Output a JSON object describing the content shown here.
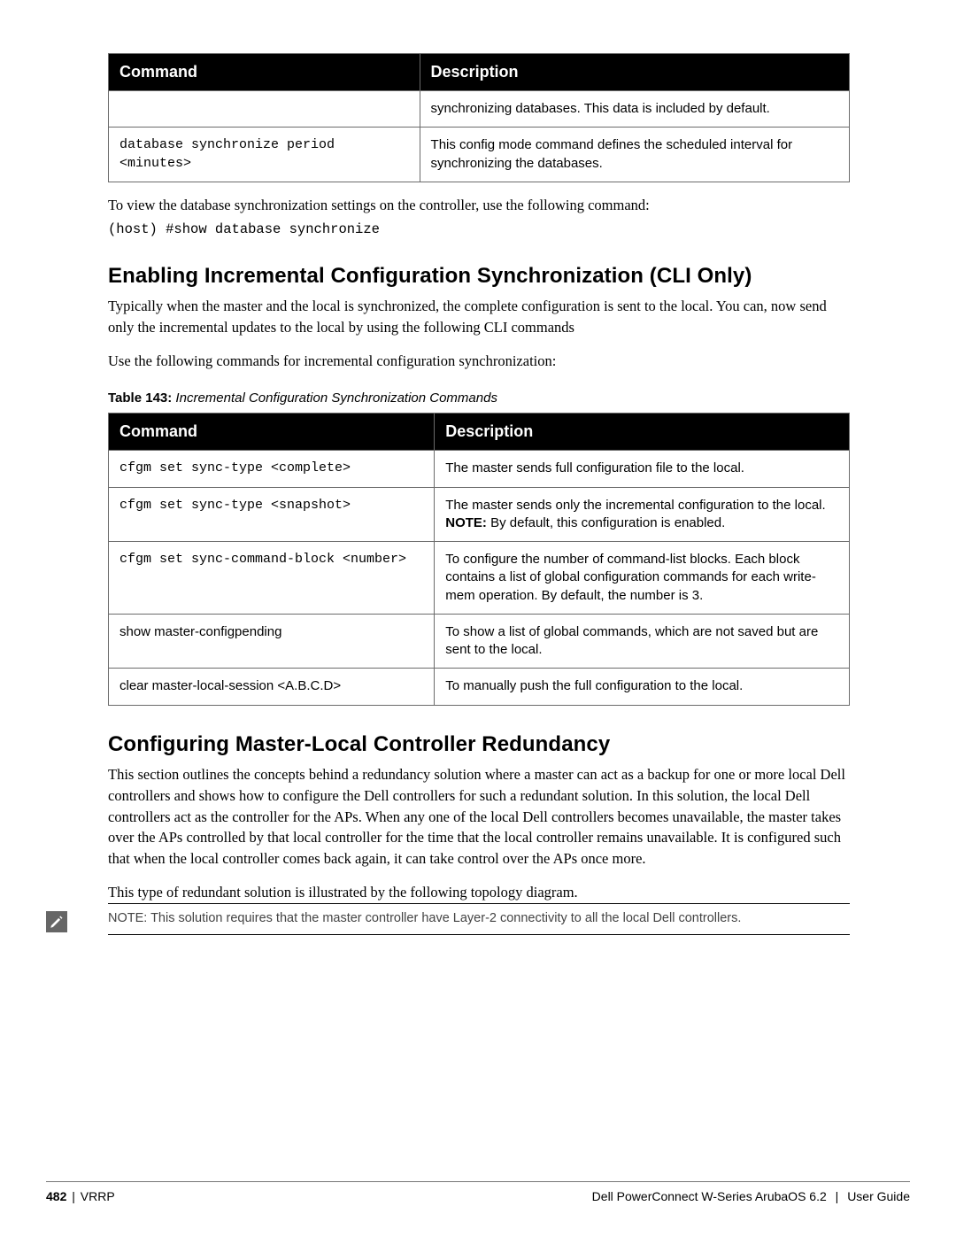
{
  "table1": {
    "headers": {
      "cmd": "Command",
      "desc": "Description"
    },
    "rows": [
      {
        "cmd": "",
        "desc": "synchronizing databases. This data is included by default."
      },
      {
        "cmd": "database synchronize period <minutes>",
        "desc": "This config mode command defines the scheduled interval for synchronizing the databases."
      }
    ]
  },
  "para1": "To view the database synchronization settings on the controller, use the following command:",
  "cli1": "(host) #show database synchronize",
  "heading1": "Enabling Incremental Configuration Synchronization (CLI Only)",
  "para2": "Typically when the master and the local is synchronized, the complete configuration is sent to the local. You can, now send only the incremental updates to the local by using the following CLI commands",
  "para3": "Use the following commands for incremental configuration synchronization:",
  "table2caption": {
    "label": "Table 143:",
    "title": " Incremental Configuration Synchronization Commands"
  },
  "table2": {
    "headers": {
      "cmd": "Command",
      "desc": "Description"
    },
    "rows": [
      {
        "cmd": "cfgm set sync-type <complete>",
        "desc": "The master sends full configuration file to the local."
      },
      {
        "cmd": "cfgm set sync-type <snapshot>",
        "desc_pre": "The master sends only the incremental configuration to the local.",
        "note_label": "NOTE:",
        "note_rest": " By default, this configuration is enabled."
      },
      {
        "cmd": "cfgm set sync-command-block <number>",
        "desc": "To configure the number of command-list blocks. Each block contains a list of global configuration commands for each write-mem operation. By default, the number is 3."
      },
      {
        "cmd": "show master-configpending",
        "desc": "To show a list of global commands, which are not saved but are sent to the local."
      },
      {
        "cmd": "clear master-local-session <A.B.C.D>",
        "desc": "To manually push the full configuration to the local."
      }
    ]
  },
  "heading2": "Configuring Master-Local Controller Redundancy",
  "para4": "This section outlines the concepts behind a redundancy solution where a master can act as a backup for one or more local Dell controllers and shows how to configure the  Dell controllers for such a redundant solution. In this solution, the local Dell controllers act as the controller for the APs. When any one of the local Dell controllers becomes unavailable, the master takes over the APs controlled by that local controller for the time that the local controller remains unavailable. It is configured such that when the local controller comes back again, it can take control over the APs once more.",
  "para5": "This type of redundant solution is illustrated by the following topology diagram.",
  "note": "NOTE: This solution requires that the master controller have Layer-2 connectivity to all the local Dell controllers.",
  "footer": {
    "page": "482",
    "section": "VRRP",
    "product": "Dell PowerConnect W-Series ArubaOS 6.2",
    "doc": "User Guide"
  }
}
